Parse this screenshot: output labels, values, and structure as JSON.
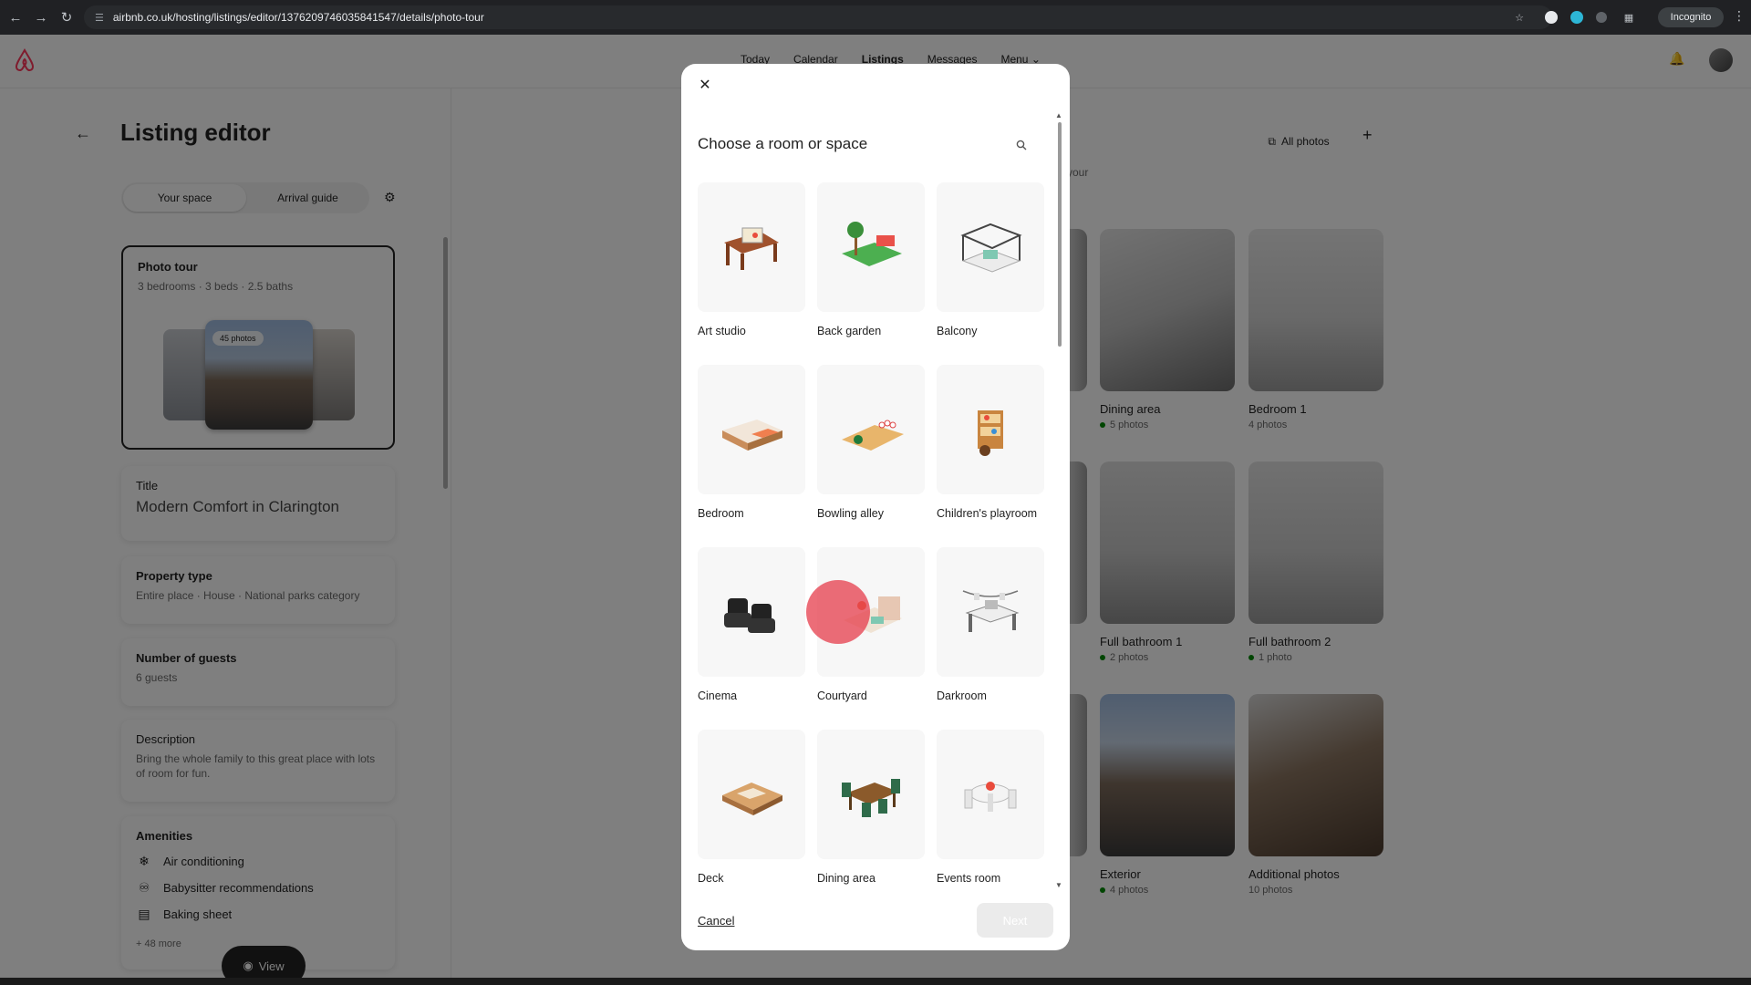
{
  "browser": {
    "url": "airbnb.co.uk/hosting/listings/editor/1376209746035841547/details/photo-tour",
    "incognito_label": "Incognito"
  },
  "topnav": {
    "links": [
      "Today",
      "Calendar",
      "Listings",
      "Messages",
      "Menu"
    ],
    "active": "Listings"
  },
  "editor": {
    "title": "Listing editor",
    "tabs": [
      "Your space",
      "Arrival guide"
    ],
    "photo_tour": {
      "heading": "Photo tour",
      "summary": "3 bedrooms · 3 beds · 2.5 baths",
      "badge": "45 photos"
    },
    "title_card": {
      "heading": "Title",
      "value": "Modern Comfort in Clarington"
    },
    "property_type": {
      "heading": "Property type",
      "value": "Entire place · House · National parks category"
    },
    "guests": {
      "heading": "Number of guests",
      "value": "6 guests"
    },
    "description": {
      "heading": "Description",
      "value": "Bring the whole family to this great place with lots of room for fun."
    },
    "amenities": {
      "heading": "Amenities",
      "items": [
        "Air conditioning",
        "Babysitter recommendations",
        "Baking sheet"
      ],
      "more": "+ 48 more"
    },
    "view_button": "View"
  },
  "photos_panel": {
    "all_photos": "All photos",
    "partial_text": "your",
    "tiles": [
      {
        "label": "Dining area",
        "count": "5 photos",
        "dot": true
      },
      {
        "label": "Bedroom 1",
        "count": "4 photos",
        "dot": false
      },
      {
        "label": "Full bathroom 1",
        "count": "2 photos",
        "dot": true
      },
      {
        "label": "Full bathroom 2",
        "count": "1 photo",
        "dot": true
      },
      {
        "label": "Exterior",
        "count": "4 photos",
        "dot": true
      },
      {
        "label": "Additional photos",
        "count": "10 photos",
        "dot": false
      }
    ]
  },
  "modal": {
    "title": "Choose a room or space",
    "rooms": [
      "Art studio",
      "Back garden",
      "Balcony",
      "Bedroom",
      "Bowling alley",
      "Children's playroom",
      "Cinema",
      "Courtyard",
      "Darkroom",
      "Deck",
      "Dining area",
      "Events room"
    ],
    "cancel": "Cancel",
    "next": "Next"
  },
  "colors": {
    "brand": "#ff385c",
    "status_dot": "#008a05"
  }
}
